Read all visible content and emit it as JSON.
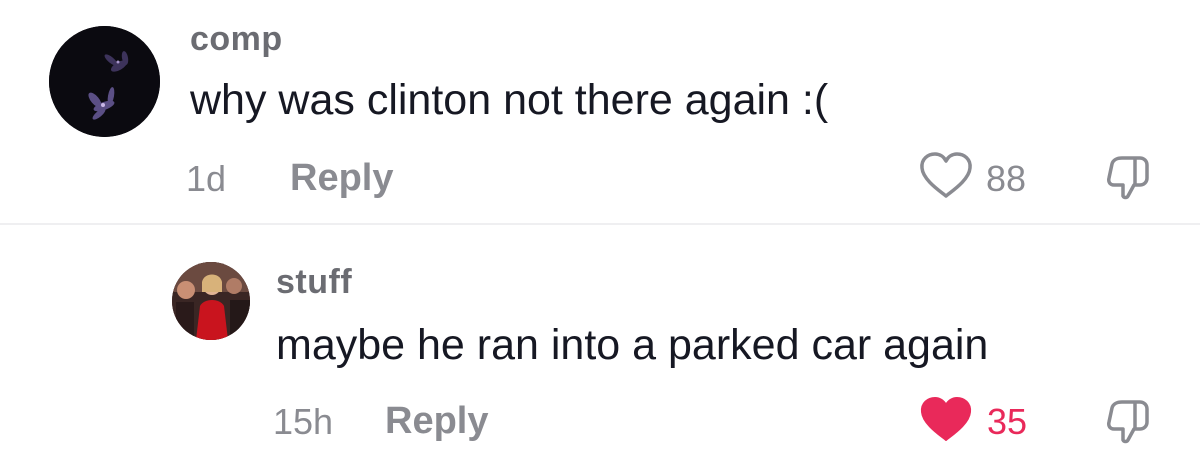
{
  "comments": [
    {
      "username": "comp",
      "text": "why was clinton not there again :(",
      "time": "1d",
      "reply_label": "Reply",
      "likes": "88",
      "liked": false,
      "avatar": "dark-purple-flowers-photo"
    },
    {
      "username": "stuff",
      "text": "maybe he ran into a parked car again",
      "time": "15h",
      "reply_label": "Reply",
      "likes": "35",
      "liked": true,
      "avatar": "woman-in-red-dress-crowd-photo"
    }
  ],
  "colors": {
    "text": "#161823",
    "muted": "#8a8b91",
    "username": "#6b6c72",
    "liked": "#e9295a",
    "divider": "#efeff1"
  },
  "icons": {
    "like": "heart-icon",
    "dislike": "thumbs-down-icon"
  }
}
